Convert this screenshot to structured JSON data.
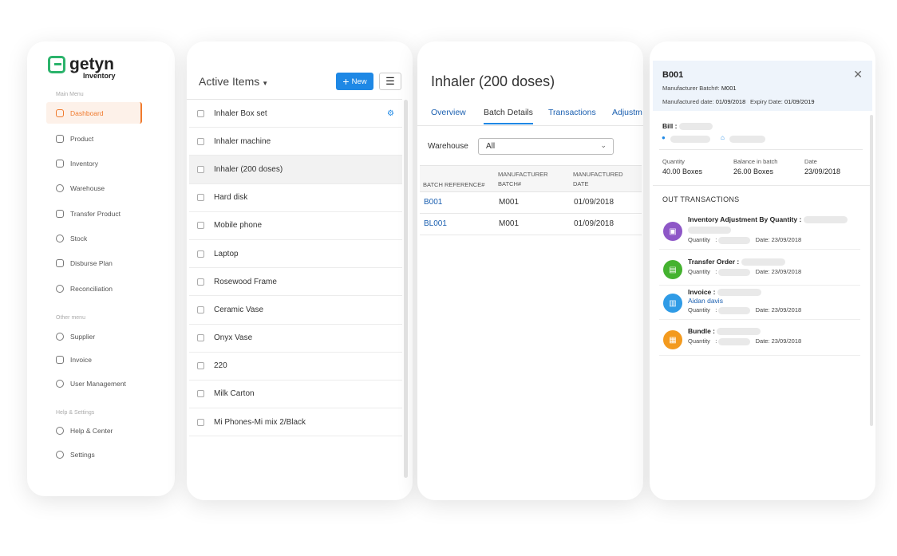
{
  "sidebar": {
    "logo_name": "getyn",
    "logo_sub": "Inventory",
    "main_menu_label": "Main Menu",
    "main_items": [
      {
        "label": "Dashboard"
      },
      {
        "label": "Product"
      },
      {
        "label": "Inventory"
      },
      {
        "label": "Warehouse"
      },
      {
        "label": "Transfer Product"
      },
      {
        "label": "Stock"
      },
      {
        "label": "Disburse Plan"
      },
      {
        "label": "Reconciliation"
      }
    ],
    "other_menu_label": "Other menu",
    "other_items": [
      {
        "label": "Supplier"
      },
      {
        "label": "Invoice"
      },
      {
        "label": "User Management"
      }
    ],
    "help_label": "Help & Settings",
    "help_items": [
      {
        "label": "Help & Center"
      },
      {
        "label": "Settings"
      }
    ],
    "active_item": "Dashboard",
    "accent_color": "#f07a2d"
  },
  "items_panel": {
    "title": "Active Items",
    "new_label": "New",
    "items": [
      "Inhaler Box set",
      "Inhaler machine",
      "Inhaler (200 doses)",
      "Hard disk",
      "Mobile phone",
      "Laptop",
      "Rosewood Frame",
      "Ceramic Vase",
      "Onyx Vase",
      "220",
      "Milk Carton",
      "Mi Phones-Mi mix 2/Black"
    ],
    "selected_item": "Inhaler (200 doses)"
  },
  "detail": {
    "title": "Inhaler (200 doses)",
    "tabs": [
      "Overview",
      "Batch Details",
      "Transactions",
      "Adjustm"
    ],
    "active_tab": "Batch Details",
    "warehouse_label": "Warehouse",
    "warehouse_value": "All",
    "columns": {
      "ref": "BATCH REFERENCE#",
      "mfg_batch_1": "MANUFACTURER",
      "mfg_batch_2": "BATCH#",
      "mfg_date_1": "MANUFACTURED",
      "mfg_date_2": "DATE"
    },
    "rows": [
      {
        "ref": "B001",
        "batch": "M001",
        "date": "01/09/2018"
      },
      {
        "ref": "BL001",
        "batch": "M001",
        "date": "01/09/2018"
      }
    ]
  },
  "batch": {
    "id": "B001",
    "mfg_batch_label": "Manufacturer Batch#:",
    "mfg_batch_value": "M001",
    "mfg_date_label": "Manufactured date:",
    "mfg_date_value": "01/09/2018",
    "expiry_label": "Expiry Date:",
    "expiry_value": "01/09/2019",
    "bill_label": "Bill :",
    "quantity_label": "Quantity",
    "quantity_value": "40.00 Boxes",
    "balance_label": "Balance in batch",
    "balance_value": "26.00 Boxes",
    "date_label": "Date",
    "date_value": "23/09/2018",
    "out_title": "OUT TRANSACTIONS",
    "transactions": [
      {
        "name": "Inventory Adjustment By Quantity :",
        "qty_label": "Quantity",
        "date": "Date: 23/09/2018",
        "color": "#8e57c7",
        "icon": "clipboard-icon"
      },
      {
        "name": "Transfer Order :",
        "qty_label": "Quantity",
        "date": "Date: 23/09/2018",
        "color": "#44b22f",
        "icon": "document-icon"
      },
      {
        "name": "Invoice :",
        "link": "Aidan davis",
        "qty_label": "Quantity",
        "date": "Date: 23/09/2018",
        "color": "#2f9be6",
        "icon": "invoice-icon"
      },
      {
        "name": "Bundle :",
        "qty_label": "Quantity",
        "date": "Date: 23/09/2018",
        "color": "#f39a1e",
        "icon": "box-icon"
      }
    ]
  }
}
